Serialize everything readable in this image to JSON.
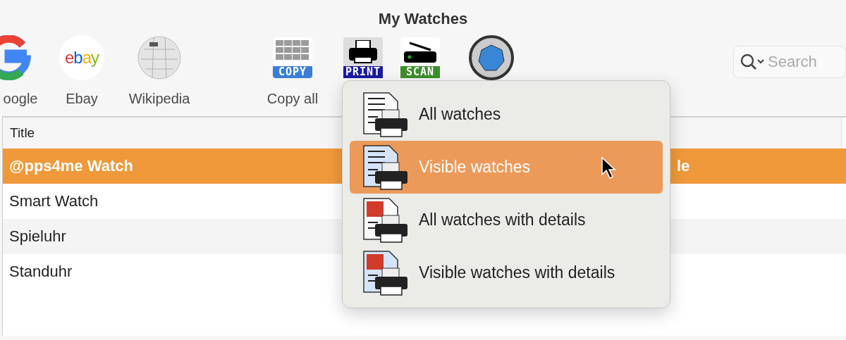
{
  "window": {
    "title": "My Watches"
  },
  "toolbar": {
    "items": [
      {
        "kind": "google",
        "label": "oogle"
      },
      {
        "kind": "ebay",
        "logo": "ebay",
        "label": "Ebay"
      },
      {
        "kind": "wiki",
        "label": "Wikipedia"
      },
      {
        "kind": "copy",
        "badge": "COPY",
        "label": "Copy all"
      },
      {
        "kind": "print",
        "badge": "PRINT"
      },
      {
        "kind": "scan",
        "badge": "SCAN"
      },
      {
        "kind": "camera"
      }
    ]
  },
  "search": {
    "placeholder": "Search"
  },
  "table": {
    "columns": [
      "Title"
    ],
    "rows": [
      {
        "title": "@pps4me Watch",
        "column_2": "le",
        "selected": true
      },
      {
        "title": "Smart Watch",
        "selected": false
      },
      {
        "title": "Spieluhr",
        "selected": false
      },
      {
        "title": "Standuhr",
        "selected": false
      }
    ]
  },
  "menu": {
    "items": [
      {
        "label": "All watches",
        "kind": "lines",
        "selected": false
      },
      {
        "label": "Visible watches",
        "kind": "lines-blue",
        "selected": true
      },
      {
        "label": "All watches with details",
        "kind": "details",
        "selected": false
      },
      {
        "label": "Visible watches with details",
        "kind": "details-blue",
        "selected": false
      }
    ]
  }
}
